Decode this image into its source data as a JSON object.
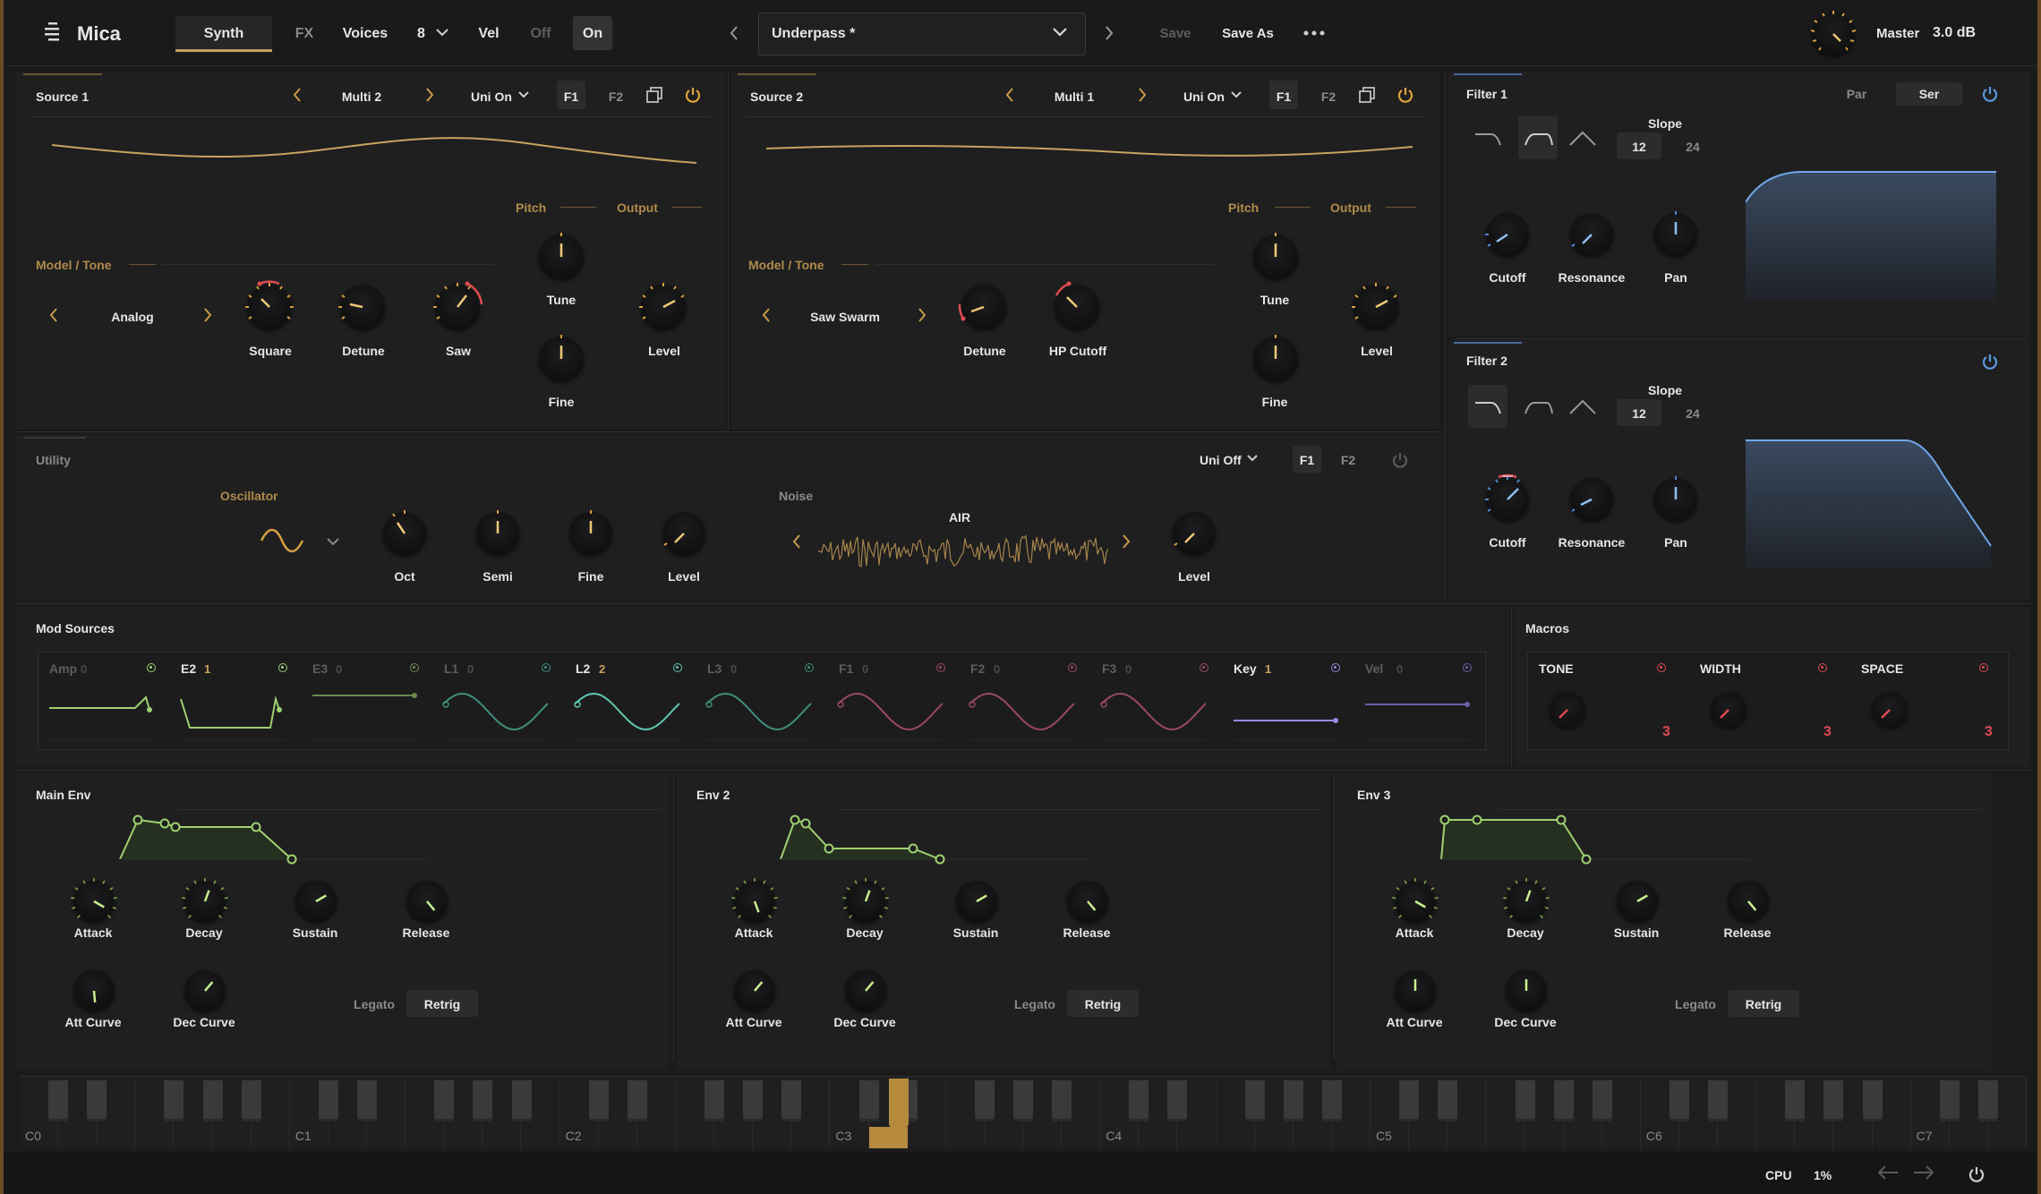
{
  "header": {
    "app_name": "Mica",
    "tabs": [
      "Synth",
      "FX",
      "Voices"
    ],
    "voices_count": "8",
    "vel_label": "Vel",
    "vel_off": "Off",
    "vel_on": "On",
    "preset_name": "Underpass *",
    "save_label": "Save",
    "save_as_label": "Save As",
    "master_label": "Master",
    "master_value": "3.0 dB"
  },
  "source1": {
    "title": "Source 1",
    "mode": "Multi 2",
    "unison": "Uni On",
    "f1": "F1",
    "f2": "F2",
    "model_tone_label": "Model / Tone",
    "model": "Analog",
    "pitch_label": "Pitch",
    "output_label": "Output",
    "knobs": [
      "Square",
      "Detune",
      "Saw",
      "Tune",
      "Level",
      "Fine"
    ]
  },
  "source2": {
    "title": "Source 2",
    "mode": "Multi 1",
    "unison": "Uni On",
    "f1": "F1",
    "f2": "F2",
    "model_tone_label": "Model / Tone",
    "model": "Saw Swarm",
    "pitch_label": "Pitch",
    "output_label": "Output",
    "knobs": [
      "Detune",
      "HP Cutoff",
      "Tune",
      "Level",
      "Fine"
    ]
  },
  "utility": {
    "title": "Utility",
    "unison": "Uni Off",
    "f1": "F1",
    "f2": "F2",
    "oscillator_label": "Oscillator",
    "noise_label": "Noise",
    "noise_type": "AIR",
    "knobs": [
      "Oct",
      "Semi",
      "Fine",
      "Level",
      "Level"
    ]
  },
  "filter1": {
    "title": "Filter 1",
    "par": "Par",
    "ser": "Ser",
    "slope_label": "Slope",
    "slope_12": "12",
    "slope_24": "24",
    "knobs": [
      "Cutoff",
      "Resonance",
      "Pan"
    ]
  },
  "filter2": {
    "title": "Filter 2",
    "slope_label": "Slope",
    "slope_12": "12",
    "slope_24": "24",
    "knobs": [
      "Cutoff",
      "Resonance",
      "Pan"
    ]
  },
  "mod_sources": {
    "title": "Mod Sources",
    "items": [
      {
        "name": "Amp",
        "count": "0",
        "color": "#9fd070"
      },
      {
        "name": "E2",
        "count": "1",
        "color": "#9fd070"
      },
      {
        "name": "E3",
        "count": "0",
        "color": "#6d8a4e"
      },
      {
        "name": "L1",
        "count": "0",
        "color": "#3f8f7c"
      },
      {
        "name": "L2",
        "count": "2",
        "color": "#5fc7b0"
      },
      {
        "name": "L3",
        "count": "0",
        "color": "#3f8f7c"
      },
      {
        "name": "F1",
        "count": "0",
        "color": "#9a4a5c"
      },
      {
        "name": "F2",
        "count": "0",
        "color": "#9a4a5c"
      },
      {
        "name": "F3",
        "count": "0",
        "color": "#9a4a5c"
      },
      {
        "name": "Key",
        "count": "1",
        "color": "#9a8ae0"
      },
      {
        "name": "Vel",
        "count": "0",
        "color": "#6a5fa8"
      }
    ]
  },
  "macros": {
    "title": "Macros",
    "items": [
      {
        "name": "TONE",
        "value": "3"
      },
      {
        "name": "WIDTH",
        "value": "3"
      },
      {
        "name": "SPACE",
        "value": "3"
      }
    ]
  },
  "envelopes": [
    {
      "title": "Main Env",
      "knobs": [
        "Attack",
        "Decay",
        "Sustain",
        "Release",
        "Att Curve",
        "Dec Curve"
      ],
      "legato": "Legato",
      "retrig": "Retrig"
    },
    {
      "title": "Env 2",
      "knobs": [
        "Attack",
        "Decay",
        "Sustain",
        "Release",
        "Att Curve",
        "Dec Curve"
      ],
      "legato": "Legato",
      "retrig": "Retrig"
    },
    {
      "title": "Env 3",
      "knobs": [
        "Attack",
        "Decay",
        "Sustain",
        "Release",
        "Att Curve",
        "Dec Curve"
      ],
      "legato": "Legato",
      "retrig": "Retrig"
    }
  ],
  "keyboard": {
    "octave_labels": [
      "C0",
      "C1",
      "C2",
      "C3",
      "C4",
      "C5",
      "C6",
      "C7"
    ]
  },
  "footer": {
    "cpu_label": "CPU",
    "cpu_value": "1%"
  }
}
